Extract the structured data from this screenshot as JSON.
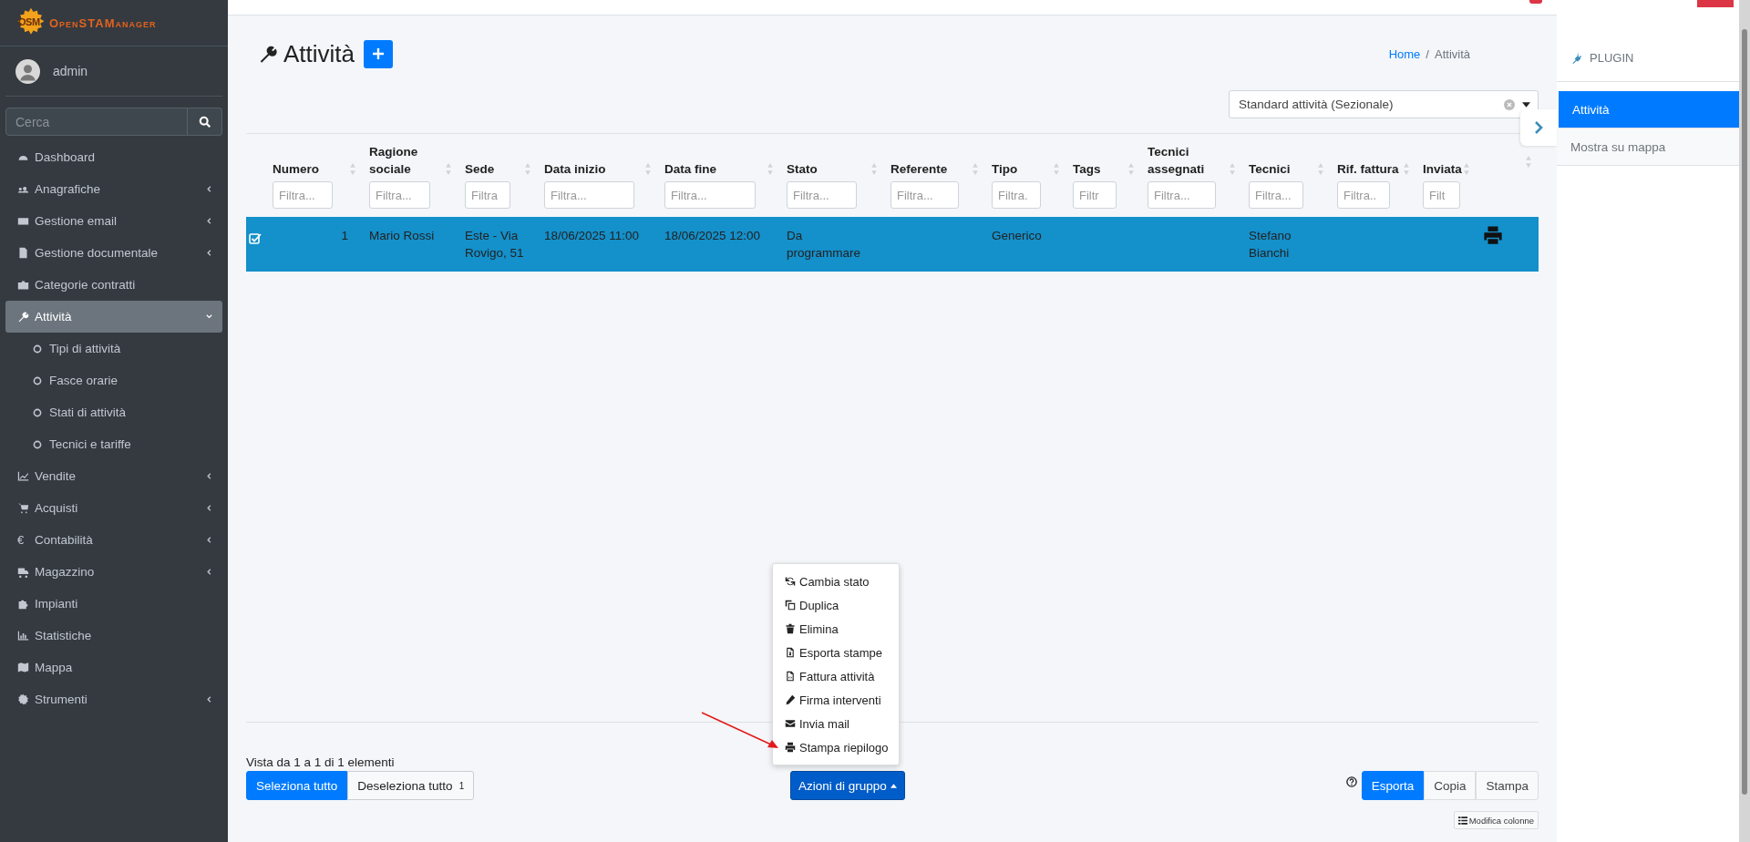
{
  "app": {
    "logo_mark": "OSM",
    "logo_text": "OpenSTAManager"
  },
  "user": {
    "name": "admin"
  },
  "sidebar_search": {
    "placeholder": "Cerca"
  },
  "sidebar": {
    "items": [
      {
        "label": "Dashboard",
        "kind": "link",
        "selected": false
      },
      {
        "label": "Anagrafiche",
        "kind": "menu",
        "expanded": false,
        "selected": false
      },
      {
        "label": "Gestione email",
        "kind": "menu",
        "expanded": false,
        "selected": false
      },
      {
        "label": "Gestione documentale",
        "kind": "menu",
        "expanded": false,
        "selected": false
      },
      {
        "label": "Categorie contratti",
        "kind": "link",
        "selected": false
      },
      {
        "label": "Attività",
        "kind": "menu",
        "expanded": true,
        "selected": true,
        "children": [
          {
            "label": "Tipi di attività",
            "selected": false
          },
          {
            "label": "Fasce orarie",
            "selected": false
          },
          {
            "label": "Stati di attività",
            "selected": false
          },
          {
            "label": "Tecnici e tariffe",
            "selected": false
          }
        ]
      },
      {
        "label": "Vendite",
        "kind": "menu",
        "expanded": false,
        "selected": false
      },
      {
        "label": "Acquisti",
        "kind": "menu",
        "expanded": false,
        "selected": false
      },
      {
        "label": "Contabilità",
        "kind": "menu",
        "expanded": false,
        "selected": false,
        "glyph": "€"
      },
      {
        "label": "Magazzino",
        "kind": "menu",
        "expanded": false,
        "selected": false
      },
      {
        "label": "Impianti",
        "kind": "link",
        "selected": false
      },
      {
        "label": "Statistiche",
        "kind": "link",
        "selected": false
      },
      {
        "label": "Mappa",
        "kind": "link",
        "selected": false
      },
      {
        "label": "Strumenti",
        "kind": "menu",
        "expanded": false,
        "selected": false
      }
    ]
  },
  "page": {
    "title": "Attività",
    "breadcrumb": [
      {
        "label": "Home",
        "kind": "link"
      },
      {
        "label": "/",
        "kind": "separator"
      },
      {
        "label": "Attività",
        "kind": "current"
      }
    ],
    "segment_select": {
      "value": "Standard attività (Sezionale)"
    }
  },
  "table": {
    "columns": [
      {
        "label": "Numero",
        "placeholder": "Filtra..."
      },
      {
        "label": "Ragione sociale",
        "placeholder": "Filtra..."
      },
      {
        "label": "Sede",
        "placeholder": "Filtra"
      },
      {
        "label": "Data inizio",
        "placeholder": "Filtra..."
      },
      {
        "label": "Data fine",
        "placeholder": "Filtra..."
      },
      {
        "label": "Stato",
        "placeholder": "Filtra..."
      },
      {
        "label": "Referente",
        "placeholder": "Filtra..."
      },
      {
        "label": "Tipo",
        "placeholder": "Filtra."
      },
      {
        "label": "Tags",
        "placeholder": "Filtr"
      },
      {
        "label": "Tecnici assegnati",
        "placeholder": "Filtra..."
      },
      {
        "label": "Tecnici",
        "placeholder": "Filtra..."
      },
      {
        "label": "Rif. fattura",
        "placeholder": "Filtra.."
      },
      {
        "label": "Inviata",
        "placeholder": "Filt"
      }
    ],
    "rows": [
      {
        "selected": true,
        "cells": [
          "1",
          "Mario Rossi",
          "Este - Via Rovigo, 51",
          "18/06/2025 11:00",
          "18/06/2025 12:00",
          "Da programmare",
          null,
          "Generico",
          null,
          null,
          "Stefano Bianchi",
          null,
          null
        ]
      }
    ]
  },
  "footer": {
    "info": "Vista da 1 a 1 di 1 elementi",
    "select_all": "Seleziona tutto",
    "deselect_all": "Deseleziona tutto",
    "selected_count": "1",
    "group_actions": {
      "label": "Azioni di gruppo",
      "expanded": true,
      "items": [
        "Cambia stato",
        "Duplica",
        "Elimina",
        "Esporta stampe",
        "Fattura attività",
        "Firma interventi",
        "Invia mail",
        "Stampa riepilogo"
      ]
    },
    "export_buttons": [
      {
        "label": "Esporta",
        "primary": true
      },
      {
        "label": "Copia",
        "primary": false
      },
      {
        "label": "Stampa",
        "primary": false
      }
    ],
    "columns_button": "Modifica colonne"
  },
  "plugins": {
    "header": "PLUGIN",
    "tabs": [
      {
        "label": "Attività",
        "selected": true
      },
      {
        "label": "Mostra su mappa",
        "selected": false
      }
    ]
  }
}
